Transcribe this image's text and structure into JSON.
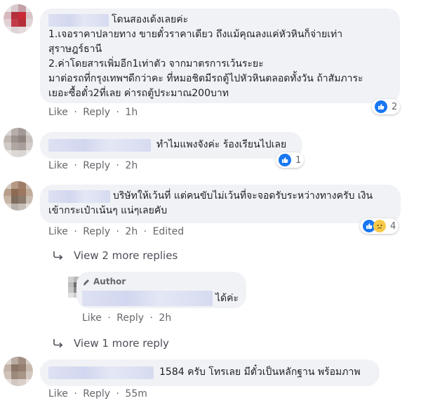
{
  "comments": [
    {
      "id": "c1",
      "text_lines": [
        "โดนสองเด้งเลยค่ะ",
        "1.เจอราคาปลายทาง ขายตั๋วราคาเดียว ถึงแม้คุณลงแค่หัวหินก็จ่ายเท่า",
        "สุราษฎร์ธานี",
        "2.ค่าโดยสารเพิ่มอีก1เท่าตัว จากมาตรการเว้นระยะ",
        "มาต่อรถที่กรุงเทพฯดีกว่าคะ ที่หมอชิตมีรถตู้ไปหัวหินตลอดทั้งวัน ถ้าสัมภาระ",
        "เยอะซื้อตั๋ว2ที่เลย ค่ารถตู้ประมาณ200บาท"
      ],
      "actions": {
        "like": "Like",
        "reply": "Reply",
        "time": "1h"
      },
      "reaction_count": "2"
    },
    {
      "id": "c2",
      "text": "ทำไมแพงจังค่ะ ร้องเรียนไปเลย",
      "actions": {
        "like": "Like",
        "reply": "Reply",
        "time": "2h"
      },
      "reaction_count": "1"
    },
    {
      "id": "c3",
      "text_lines": [
        "บริษัทให้เว้นที่ แต่คนขับไม่เว้นที่จะจอดรับระหว่างทางครับ เงิน",
        "เข้ากระเป๋าเน้นๆ แน่ๆเลยคับ"
      ],
      "actions": {
        "like": "Like",
        "reply": "Reply",
        "time": "2h",
        "edited": "Edited"
      },
      "reaction_count": "4"
    },
    {
      "id": "c4",
      "text": "1584 ครับ โทรเลย มีตั๋วเป็นหลักฐาน พร้อมภาพ",
      "actions": {
        "like": "Like",
        "reply": "Reply",
        "time": "55m"
      }
    }
  ],
  "replies_c3": {
    "view_more_label": "View 2 more replies",
    "reply": {
      "author_tag": "Author",
      "text": "ได้ค่ะ",
      "actions": {
        "like": "Like",
        "reply": "Reply",
        "time": "2h"
      }
    },
    "view_more_label_2": "View 1 more reply"
  },
  "colors": {
    "link_blue": "#1877f2",
    "secondary_text": "#65676b",
    "bubble_bg": "#f0f2f5"
  }
}
